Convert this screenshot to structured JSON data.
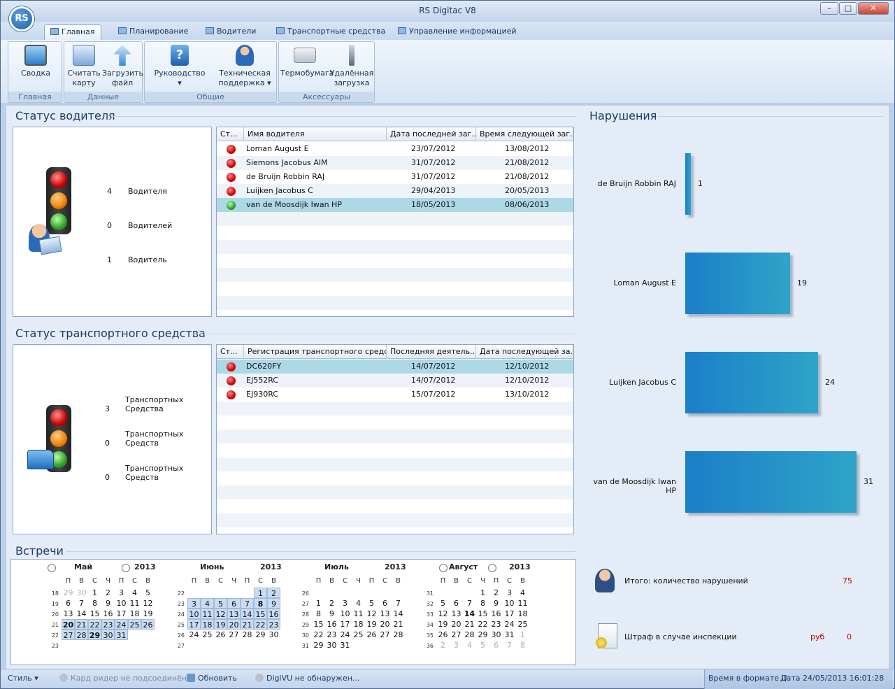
{
  "window": {
    "title": "RS Digitac V8",
    "logo_text": "RS"
  },
  "tabs": [
    {
      "label": "Главная",
      "active": true
    },
    {
      "label": "Планирование"
    },
    {
      "label": "Водители"
    },
    {
      "label": "Транспортные средства"
    },
    {
      "label": "Управление информацией"
    }
  ],
  "ribbon": {
    "groups": [
      {
        "title": "Главная",
        "buttons": [
          {
            "label1": "Сводка",
            "label2": ""
          }
        ]
      },
      {
        "title": "Данные",
        "buttons": [
          {
            "label1": "Считать",
            "label2": "карту"
          },
          {
            "label1": "Загрузить",
            "label2": "файл"
          }
        ]
      },
      {
        "title": "Общие",
        "buttons": [
          {
            "label1": "Руководство",
            "label2": "▾"
          },
          {
            "label1": "Техническая",
            "label2": "поддержка ▾"
          }
        ]
      },
      {
        "title": "Аксессуары",
        "buttons": [
          {
            "label1": "Термобумага",
            "label2": ""
          },
          {
            "label1": "Удалённая",
            "label2": "загрузка"
          }
        ]
      }
    ]
  },
  "driver_status": {
    "title": "Статус водителя",
    "counts": [
      {
        "value": "4",
        "label": "Водителя"
      },
      {
        "value": "0",
        "label": "Водителей"
      },
      {
        "value": "1",
        "label": "Водитель"
      }
    ],
    "columns": [
      "Ст...",
      "Имя водителя",
      "Дата последней заг...",
      "Время следующей заг..."
    ],
    "rows": [
      {
        "status": "red",
        "name": "Loman August E",
        "last": "23/07/2012",
        "next": "13/08/2012"
      },
      {
        "status": "red",
        "name": "Siemons Jacobus AIM",
        "last": "31/07/2012",
        "next": "21/08/2012"
      },
      {
        "status": "red",
        "name": "de Bruijn Robbin RAJ",
        "last": "31/07/2012",
        "next": "21/08/2012"
      },
      {
        "status": "red",
        "name": "Luijken Jacobus C",
        "last": "29/04/2013",
        "next": "20/05/2013"
      },
      {
        "status": "green",
        "name": "van de Moosdijk Iwan HP",
        "last": "18/05/2013",
        "next": "08/06/2013"
      }
    ]
  },
  "vehicle_status": {
    "title": "Статус транспортного средства",
    "counts": [
      {
        "value": "3",
        "label1": "Транспортных",
        "label2": "Средства"
      },
      {
        "value": "0",
        "label1": "Транспортных",
        "label2": "Средств"
      },
      {
        "value": "0",
        "label1": "Транспортных",
        "label2": "Средств"
      }
    ],
    "columns": [
      "Ст...",
      "Регистрация транспортного средства",
      "Последняя деятель...",
      "Дата последующей за..."
    ],
    "rows": [
      {
        "status": "red",
        "reg": "DC620FY",
        "last": "14/07/2012",
        "next": "12/10/2012"
      },
      {
        "status": "red",
        "reg": "EJ552RC",
        "last": "14/07/2012",
        "next": "12/10/2012"
      },
      {
        "status": "red",
        "reg": "EJ930RC",
        "last": "15/07/2012",
        "next": "13/10/2012"
      }
    ]
  },
  "violations": {
    "title": "Нарушения",
    "total_label": "Итого: количество нарушений",
    "total_value": "75",
    "fine_label": "Штраф в случае инспекции",
    "fine_currency": "руб",
    "fine_value": "0"
  },
  "chart_data": {
    "type": "bar",
    "orientation": "horizontal",
    "categories": [
      "de Bruijn Robbin RAJ",
      "Loman August E",
      "Luijken Jacobus C",
      "van de Moosdijk Iwan HP"
    ],
    "values": [
      1,
      19,
      24,
      31
    ],
    "xlim": [
      0,
      31
    ],
    "title": "",
    "xlabel": "",
    "ylabel": ""
  },
  "meetings": {
    "title": "Встречи",
    "dow": [
      "П",
      "В",
      "С",
      "Ч",
      "П",
      "С",
      "В"
    ],
    "months": [
      {
        "name": "Май",
        "year": "2013",
        "weeks": [
          "18",
          "19",
          "20",
          "21",
          "22",
          "23"
        ],
        "rows": [
          [
            "29",
            "30",
            "1",
            "2",
            "3",
            "4",
            "5"
          ],
          [
            "6",
            "7",
            "8",
            "9",
            "10",
            "11",
            "12"
          ],
          [
            "13",
            "14",
            "15",
            "16",
            "17",
            "18",
            "19"
          ],
          [
            "20",
            "21",
            "22",
            "23",
            "24",
            "25",
            "26"
          ],
          [
            "27",
            "28",
            "29",
            "30",
            "31",
            "",
            ""
          ],
          [
            "",
            "",
            "",
            "",
            "",
            "",
            ""
          ]
        ]
      },
      {
        "name": "Июнь",
        "year": "2013",
        "weeks": [
          "22",
          "23",
          "24",
          "25",
          "26",
          "27"
        ],
        "rows": [
          [
            "",
            "",
            "",
            "",
            "",
            "1",
            "2"
          ],
          [
            "3",
            "4",
            "5",
            "6",
            "7",
            "8",
            "9"
          ],
          [
            "10",
            "11",
            "12",
            "13",
            "14",
            "15",
            "16"
          ],
          [
            "17",
            "18",
            "19",
            "20",
            "21",
            "22",
            "23"
          ],
          [
            "24",
            "25",
            "26",
            "27",
            "28",
            "29",
            "30"
          ],
          [
            "",
            "",
            "",
            "",
            "",
            "",
            ""
          ]
        ]
      },
      {
        "name": "Июль",
        "year": "2013",
        "weeks": [
          "26",
          "27",
          "28",
          "29",
          "30",
          "31"
        ],
        "rows": [
          [
            "",
            "",
            "",
            "",
            "",
            "",
            ""
          ],
          [
            "1",
            "2",
            "3",
            "4",
            "5",
            "6",
            "7"
          ],
          [
            "8",
            "9",
            "10",
            "11",
            "12",
            "13",
            "14"
          ],
          [
            "15",
            "16",
            "17",
            "18",
            "19",
            "20",
            "21"
          ],
          [
            "22",
            "23",
            "24",
            "25",
            "26",
            "27",
            "28"
          ],
          [
            "29",
            "30",
            "31",
            "",
            "",
            "",
            ""
          ]
        ]
      },
      {
        "name": "Август",
        "year": "2013",
        "weeks": [
          "31",
          "32",
          "33",
          "34",
          "35",
          "36"
        ],
        "rows": [
          [
            "",
            "",
            "",
            "1",
            "2",
            "3",
            "4"
          ],
          [
            "5",
            "6",
            "7",
            "8",
            "9",
            "10",
            "11"
          ],
          [
            "12",
            "13",
            "14",
            "15",
            "16",
            "17",
            "18"
          ],
          [
            "19",
            "20",
            "21",
            "22",
            "23",
            "24",
            "25"
          ],
          [
            "26",
            "27",
            "28",
            "29",
            "30",
            "31",
            "1"
          ],
          [
            "2",
            "3",
            "4",
            "5",
            "6",
            "7",
            "8"
          ]
        ]
      }
    ]
  },
  "statusbar": {
    "style": "Стиль",
    "card_reader": "Кард ридер не подсоединён...",
    "refresh": "Обновить",
    "digivu": "DigiVU не обнаружен...",
    "time_format": "Время в формате U",
    "date_label": "Дата",
    "datetime": "24/05/2013 16:01:28"
  }
}
